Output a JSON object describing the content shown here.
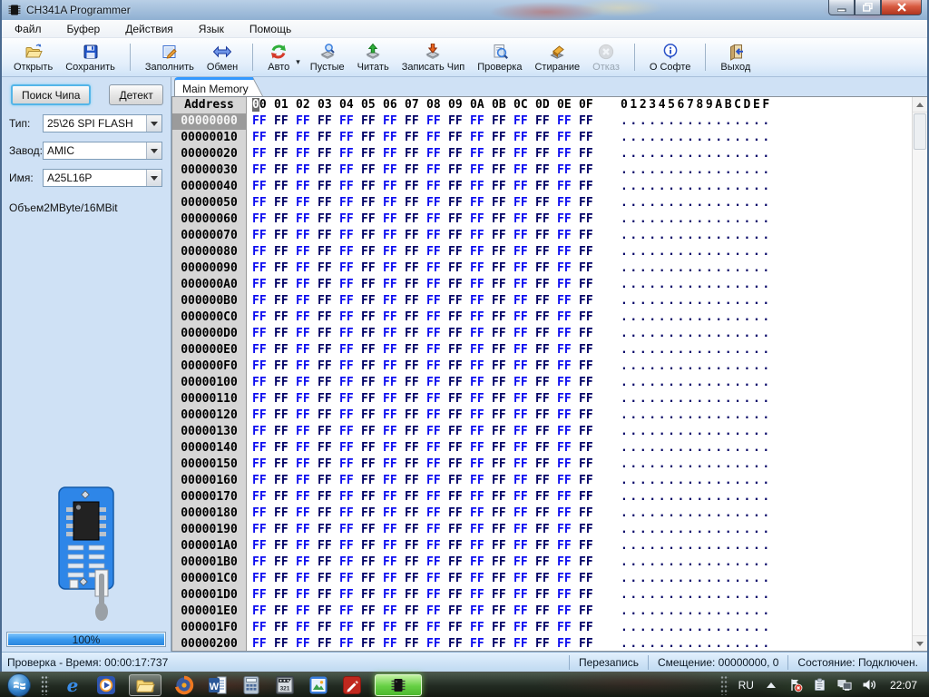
{
  "window": {
    "title": "CH341A Programmer"
  },
  "menu": {
    "items": [
      "Файл",
      "Буфер",
      "Действия",
      "Язык",
      "Помощь"
    ]
  },
  "toolbar": {
    "groups": [
      [
        {
          "label": "Открыть",
          "icon": "open-folder-icon"
        },
        {
          "label": "Сохранить",
          "icon": "save-icon"
        }
      ],
      [
        {
          "label": "Заполнить",
          "icon": "fill-icon"
        },
        {
          "label": "Обмен",
          "icon": "swap-icon"
        }
      ],
      [
        {
          "label": "Авто",
          "icon": "auto-icon",
          "has_dropdown": true
        },
        {
          "label": "Пустые",
          "icon": "blank-check-icon"
        },
        {
          "label": "Читать",
          "icon": "read-chip-icon"
        },
        {
          "label": "Записать Чип",
          "icon": "write-chip-icon"
        },
        {
          "label": "Проверка",
          "icon": "verify-icon"
        },
        {
          "label": "Стирание",
          "icon": "erase-icon"
        },
        {
          "label": "Отказ",
          "icon": "cancel-icon",
          "disabled": true
        }
      ],
      [
        {
          "label": "О Софте",
          "icon": "about-icon"
        }
      ],
      [
        {
          "label": "Выход",
          "icon": "exit-icon"
        }
      ]
    ]
  },
  "chip_panel": {
    "search_button": "Поиск Чипа",
    "detect_button": "Детект",
    "fields": [
      {
        "label": "Тип:",
        "value": "25\\26 SPI FLASH"
      },
      {
        "label": "Завод:",
        "value": "AMIC"
      },
      {
        "label": "Имя:",
        "value": "A25L16P"
      }
    ],
    "size_label": "Объем2MByte/16MBit",
    "progress_text": "100%"
  },
  "hex_view": {
    "tab": "Main Memory",
    "address_header": "Address",
    "byte_headers": [
      "00",
      "01",
      "02",
      "03",
      "04",
      "05",
      "06",
      "07",
      "08",
      "09",
      "0A",
      "0B",
      "0C",
      "0D",
      "0E",
      "0F"
    ],
    "ascii_header": "0123456789ABCDEF",
    "rows": [
      {
        "address": "00000000",
        "bytes": "FF FF FF FF FF FF FF FF FF FF FF FF FF FF FF FF",
        "ascii": "................"
      },
      {
        "address": "00000010",
        "bytes": "FF FF FF FF FF FF FF FF FF FF FF FF FF FF FF FF",
        "ascii": "................"
      },
      {
        "address": "00000020",
        "bytes": "FF FF FF FF FF FF FF FF FF FF FF FF FF FF FF FF",
        "ascii": "................"
      },
      {
        "address": "00000030",
        "bytes": "FF FF FF FF FF FF FF FF FF FF FF FF FF FF FF FF",
        "ascii": "................"
      },
      {
        "address": "00000040",
        "bytes": "FF FF FF FF FF FF FF FF FF FF FF FF FF FF FF FF",
        "ascii": "................"
      },
      {
        "address": "00000050",
        "bytes": "FF FF FF FF FF FF FF FF FF FF FF FF FF FF FF FF",
        "ascii": "................"
      },
      {
        "address": "00000060",
        "bytes": "FF FF FF FF FF FF FF FF FF FF FF FF FF FF FF FF",
        "ascii": "................"
      },
      {
        "address": "00000070",
        "bytes": "FF FF FF FF FF FF FF FF FF FF FF FF FF FF FF FF",
        "ascii": "................"
      },
      {
        "address": "00000080",
        "bytes": "FF FF FF FF FF FF FF FF FF FF FF FF FF FF FF FF",
        "ascii": "................"
      },
      {
        "address": "00000090",
        "bytes": "FF FF FF FF FF FF FF FF FF FF FF FF FF FF FF FF",
        "ascii": "................"
      },
      {
        "address": "000000A0",
        "bytes": "FF FF FF FF FF FF FF FF FF FF FF FF FF FF FF FF",
        "ascii": "................"
      },
      {
        "address": "000000B0",
        "bytes": "FF FF FF FF FF FF FF FF FF FF FF FF FF FF FF FF",
        "ascii": "................"
      },
      {
        "address": "000000C0",
        "bytes": "FF FF FF FF FF FF FF FF FF FF FF FF FF FF FF FF",
        "ascii": "................"
      },
      {
        "address": "000000D0",
        "bytes": "FF FF FF FF FF FF FF FF FF FF FF FF FF FF FF FF",
        "ascii": "................"
      },
      {
        "address": "000000E0",
        "bytes": "FF FF FF FF FF FF FF FF FF FF FF FF FF FF FF FF",
        "ascii": "................"
      },
      {
        "address": "000000F0",
        "bytes": "FF FF FF FF FF FF FF FF FF FF FF FF FF FF FF FF",
        "ascii": "................"
      },
      {
        "address": "00000100",
        "bytes": "FF FF FF FF FF FF FF FF FF FF FF FF FF FF FF FF",
        "ascii": "................"
      },
      {
        "address": "00000110",
        "bytes": "FF FF FF FF FF FF FF FF FF FF FF FF FF FF FF FF",
        "ascii": "................"
      },
      {
        "address": "00000120",
        "bytes": "FF FF FF FF FF FF FF FF FF FF FF FF FF FF FF FF",
        "ascii": "................"
      },
      {
        "address": "00000130",
        "bytes": "FF FF FF FF FF FF FF FF FF FF FF FF FF FF FF FF",
        "ascii": "................"
      },
      {
        "address": "00000140",
        "bytes": "FF FF FF FF FF FF FF FF FF FF FF FF FF FF FF FF",
        "ascii": "................"
      },
      {
        "address": "00000150",
        "bytes": "FF FF FF FF FF FF FF FF FF FF FF FF FF FF FF FF",
        "ascii": "................"
      },
      {
        "address": "00000160",
        "bytes": "FF FF FF FF FF FF FF FF FF FF FF FF FF FF FF FF",
        "ascii": "................"
      },
      {
        "address": "00000170",
        "bytes": "FF FF FF FF FF FF FF FF FF FF FF FF FF FF FF FF",
        "ascii": "................"
      },
      {
        "address": "00000180",
        "bytes": "FF FF FF FF FF FF FF FF FF FF FF FF FF FF FF FF",
        "ascii": "................"
      },
      {
        "address": "00000190",
        "bytes": "FF FF FF FF FF FF FF FF FF FF FF FF FF FF FF FF",
        "ascii": "................"
      },
      {
        "address": "000001A0",
        "bytes": "FF FF FF FF FF FF FF FF FF FF FF FF FF FF FF FF",
        "ascii": "................"
      },
      {
        "address": "000001B0",
        "bytes": "FF FF FF FF FF FF FF FF FF FF FF FF FF FF FF FF",
        "ascii": "................"
      },
      {
        "address": "000001C0",
        "bytes": "FF FF FF FF FF FF FF FF FF FF FF FF FF FF FF FF",
        "ascii": "................"
      },
      {
        "address": "000001D0",
        "bytes": "FF FF FF FF FF FF FF FF FF FF FF FF FF FF FF FF",
        "ascii": "................"
      },
      {
        "address": "000001E0",
        "bytes": "FF FF FF FF FF FF FF FF FF FF FF FF FF FF FF FF",
        "ascii": "................"
      },
      {
        "address": "000001F0",
        "bytes": "FF FF FF FF FF FF FF FF FF FF FF FF FF FF FF FF",
        "ascii": "................"
      },
      {
        "address": "00000200",
        "bytes": "FF FF FF FF FF FF FF FF FF FF FF FF FF FF FF FF",
        "ascii": "................"
      }
    ]
  },
  "statusbar": {
    "left": "Проверка - Время: 00:00:17:737",
    "mode": "Перезапись",
    "offset": "Смещение: 00000000, 0",
    "state": "Состояние: Подключен."
  },
  "taskbar": {
    "apps": [
      {
        "name": "internet-explorer",
        "icon": "ie-icon"
      },
      {
        "name": "media-player",
        "icon": "wmp-icon"
      },
      {
        "name": "file-explorer",
        "icon": "explorer-folder-icon",
        "active": true
      },
      {
        "name": "firefox",
        "icon": "firefox-icon"
      },
      {
        "name": "word",
        "icon": "word-icon"
      },
      {
        "name": "calculator",
        "icon": "calculator-icon"
      },
      {
        "name": "media-player-classic",
        "icon": "mpc-icon"
      },
      {
        "name": "image-viewer",
        "icon": "image-viewer-icon"
      },
      {
        "name": "red-editor",
        "icon": "red-editor-icon"
      },
      {
        "name": "ch341a-programmer",
        "icon": "chip-taskbar-icon",
        "green": true
      }
    ],
    "tray": {
      "language": "RU",
      "icons": [
        "hidden-icons-arrow",
        "action-center-icon",
        "clipboard-icon",
        "network-icon",
        "volume-icon"
      ],
      "time": "22:07"
    }
  },
  "colors": {
    "byte_even": "#0d0df0",
    "byte_odd": "#000066",
    "accent": "#3399ff",
    "progress": "#399af0"
  }
}
